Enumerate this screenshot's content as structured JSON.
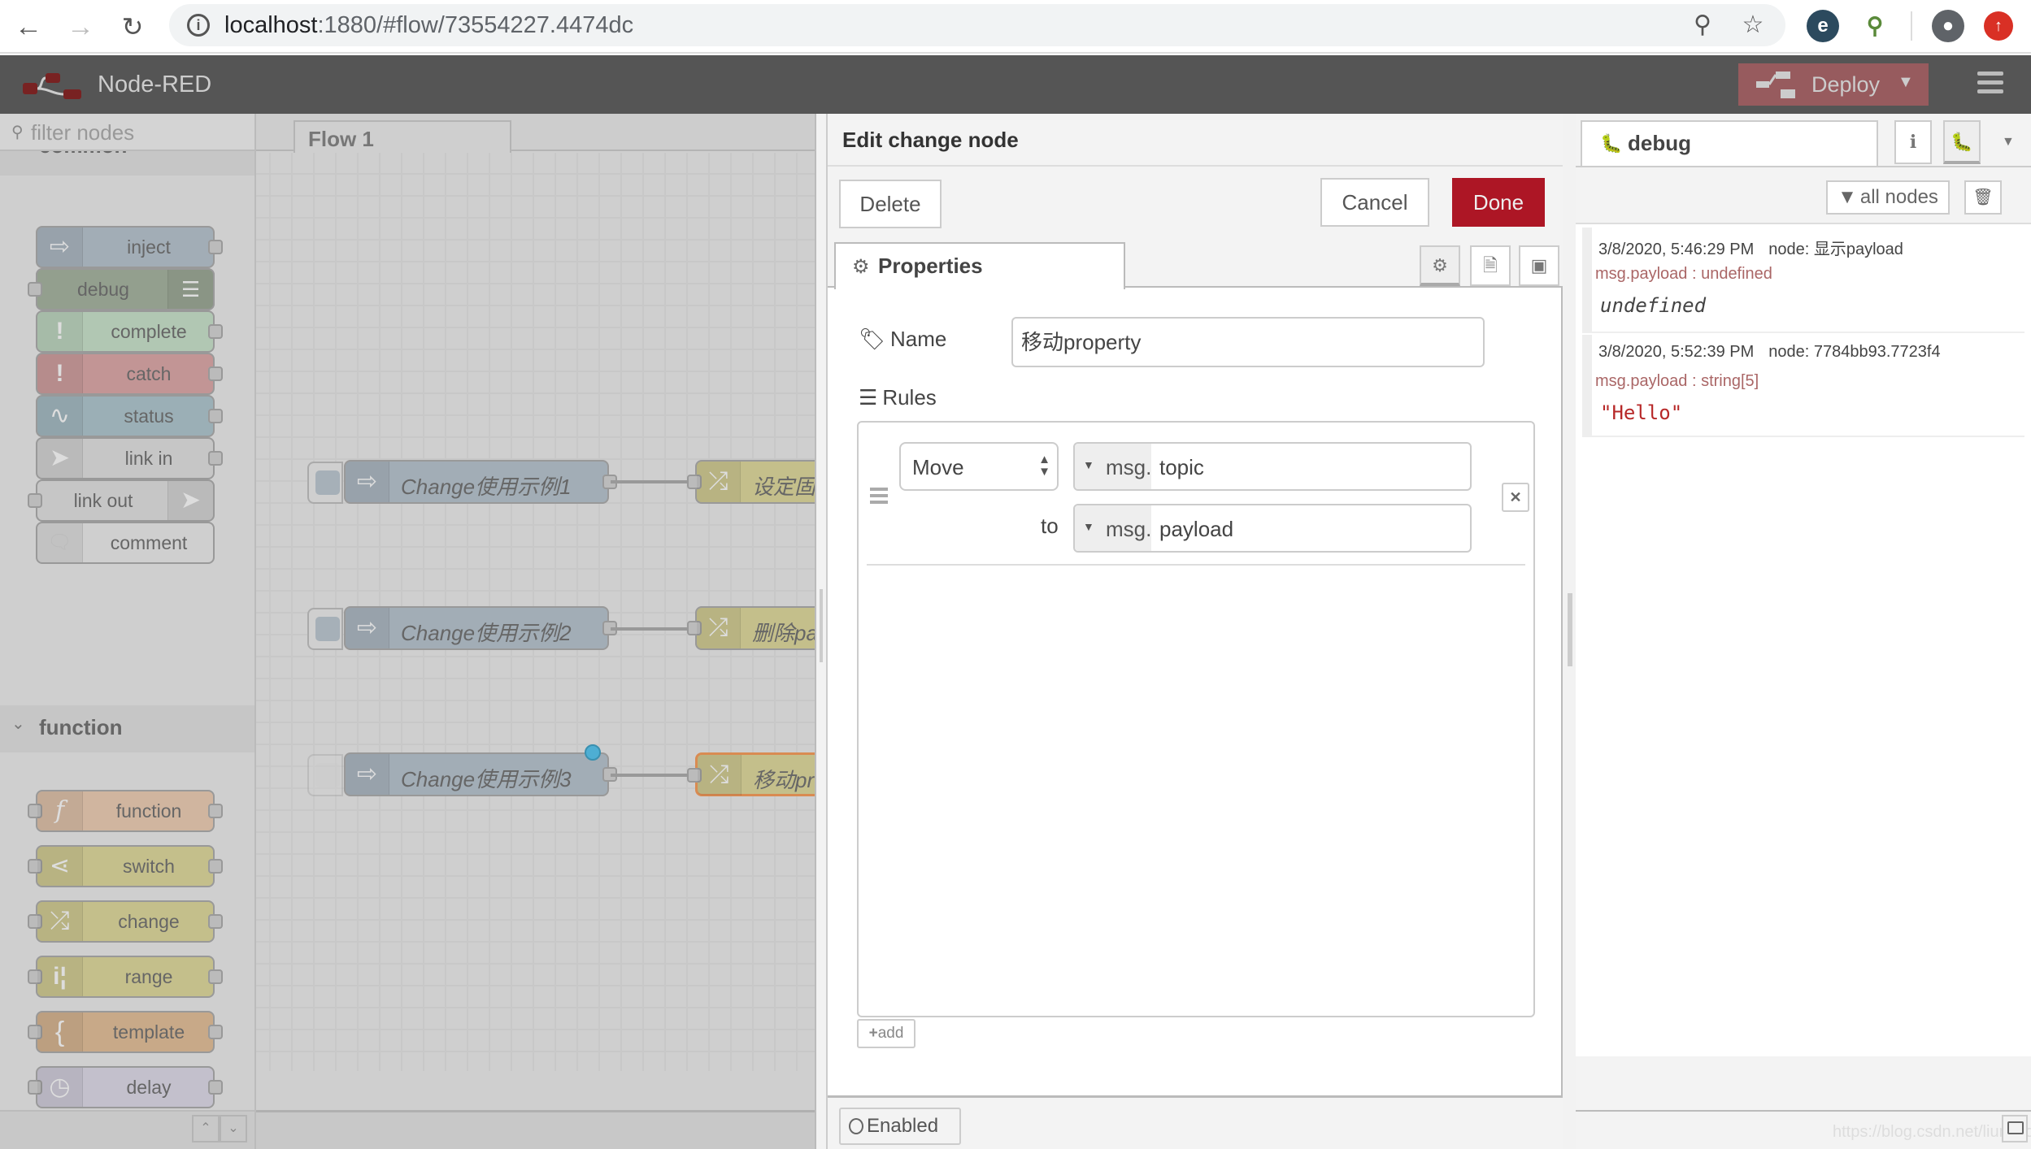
{
  "browser": {
    "url_host": "localhost",
    "url_path": ":1880/#flow/73554227.4474dc",
    "back_icon": "arrow-left-icon",
    "forward_icon": "arrow-right-icon",
    "reload_icon": "reload-icon"
  },
  "header": {
    "app_title": "Node-RED",
    "deploy_label": "Deploy"
  },
  "palette": {
    "filter_placeholder": "filter nodes",
    "categories": [
      {
        "label": "common",
        "nodes": [
          {
            "label": "inject",
            "color": "#a6bbcf"
          },
          {
            "label": "debug",
            "color": "#87a980"
          },
          {
            "label": "complete",
            "color": "#c0deed"
          },
          {
            "label": "catch",
            "color": "#e49191"
          },
          {
            "label": "status",
            "color": "#94c1d0"
          },
          {
            "label": "link in",
            "color": "#dddddd"
          },
          {
            "label": "link out",
            "color": "#dddddd"
          },
          {
            "label": "comment",
            "color": "#ffffff"
          }
        ]
      },
      {
        "label": "function",
        "nodes": [
          {
            "label": "function",
            "color": "#fdd0a2"
          },
          {
            "label": "switch",
            "color": "#e2d96e"
          },
          {
            "label": "change",
            "color": "#e2d96e"
          },
          {
            "label": "range",
            "color": "#e2d96e"
          },
          {
            "label": "template",
            "color": "#ebc08d"
          },
          {
            "label": "delay",
            "color": "#e6e0f8"
          }
        ]
      }
    ]
  },
  "workspace": {
    "tab_label": "Flow 1",
    "flow_nodes": [
      {
        "inject_label": "Change使用示例1",
        "change_label": "设定固"
      },
      {
        "inject_label": "Change使用示例2",
        "change_label": "删除pa"
      },
      {
        "inject_label": "Change使用示例3",
        "change_label": "移动pro"
      }
    ]
  },
  "editor": {
    "title": "Edit change node",
    "delete_label": "Delete",
    "cancel_label": "Cancel",
    "done_label": "Done",
    "done_color": "#ad1625",
    "properties_tab_label": "Properties",
    "name_label": "Name",
    "name_value": "移动property",
    "rules_label": "Rules",
    "rule": {
      "action": "Move",
      "from_type": "msg.",
      "from_value": "topic",
      "to_label": "to",
      "to_type": "msg.",
      "to_value": "payload"
    },
    "add_label": "add",
    "enabled_label": "Enabled"
  },
  "sidebar": {
    "tab_label": "debug",
    "filter_label": "all nodes",
    "messages": [
      {
        "timestamp": "3/8/2020, 5:46:29 PM",
        "node": "node: 显示payload",
        "property": "msg.payload : undefined",
        "value": "undefined",
        "kind": "undefined"
      },
      {
        "timestamp": "3/8/2020, 5:52:39 PM",
        "node": "node: 7784bb93.7723f4",
        "property": "msg.payload : string[5]",
        "value": "\"Hello\"",
        "kind": "string"
      }
    ],
    "watermark": "https://blog.csdn.net/liumiaocn"
  }
}
